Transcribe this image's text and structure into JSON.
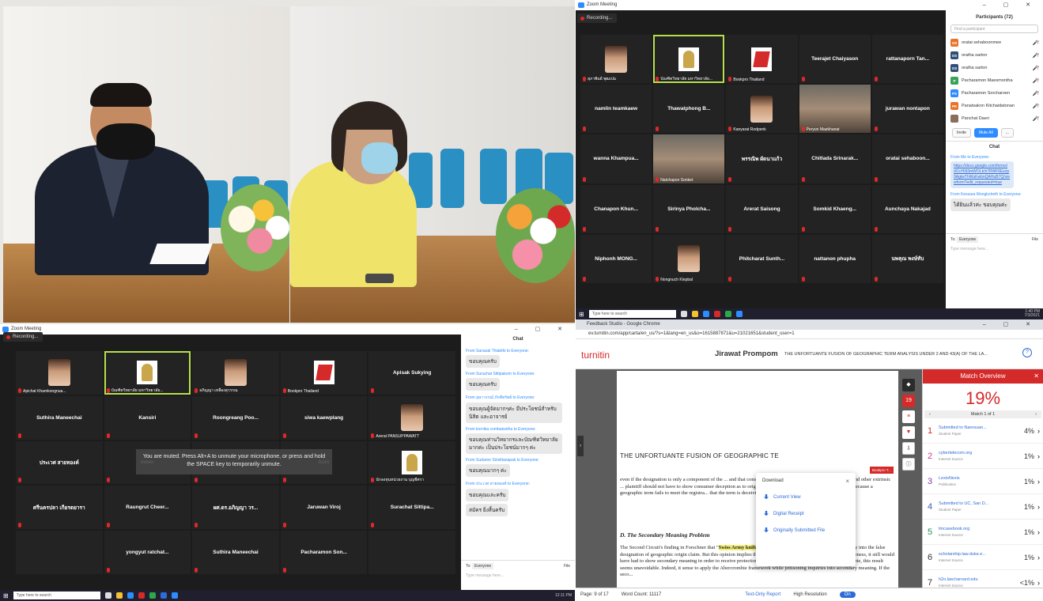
{
  "zoom_top": {
    "title": "Zoom Meeting",
    "recording": "Recording...",
    "tiles": [
      {
        "label": "",
        "name": "สุภาพิมย์ พุฒเปม",
        "kind": "face"
      },
      {
        "label": "",
        "name": "บัณฑิตวิทยาลัย มหาวิทยาลัย...",
        "kind": "emblem",
        "active": true
      },
      {
        "label": "",
        "name": "Bookpro Thailand",
        "kind": "redlogo"
      },
      {
        "label": "Teerajet Chaiyason",
        "name": "",
        "kind": "text"
      },
      {
        "label": "rattanaporn Tan...",
        "name": "",
        "kind": "text"
      },
      {
        "label": "namlin teamkaew",
        "name": "",
        "kind": "text"
      },
      {
        "label": "Thawatphong B...",
        "name": "",
        "kind": "text"
      },
      {
        "label": "",
        "name": "Kanyarat Rodpenk",
        "kind": "face"
      },
      {
        "label": "",
        "name": "Peryun Maekhanat",
        "kind": "video"
      },
      {
        "label": "jurawan nontapon",
        "name": "",
        "kind": "text"
      },
      {
        "label": "wanna Khampua...",
        "name": "",
        "kind": "text"
      },
      {
        "label": "",
        "name": "Natchapon Sonket",
        "kind": "video"
      },
      {
        "label": "พรรณิพ ผัดนาแก้ว",
        "name": "",
        "kind": "text"
      },
      {
        "label": "Chitlada Srinarak...",
        "name": "",
        "kind": "text"
      },
      {
        "label": "oratai sehaboon...",
        "name": "",
        "kind": "text"
      },
      {
        "label": "Chanapon Khun...",
        "name": "",
        "kind": "text"
      },
      {
        "label": "Sirinya Pholcha...",
        "name": "",
        "kind": "text"
      },
      {
        "label": "Arerat Saisong",
        "name": "",
        "kind": "text"
      },
      {
        "label": "Somkid Khaeng...",
        "name": "",
        "kind": "text"
      },
      {
        "label": "Aunchaya Nakajad",
        "name": "",
        "kind": "text"
      },
      {
        "label": "Niphonh MONG...",
        "name": "",
        "kind": "text"
      },
      {
        "label": "",
        "name": "Nongnuch Klepbal",
        "kind": "face"
      },
      {
        "label": "Phitcharat Sunth...",
        "name": "",
        "kind": "text"
      },
      {
        "label": "nattanon phupha",
        "name": "",
        "kind": "text"
      },
      {
        "label": "นพคุณ พงษ์ทับ",
        "name": "",
        "kind": "text"
      }
    ],
    "participants_title": "Participants (72)",
    "search_placeholder": "Find a participant",
    "participants": [
      {
        "initials": "OS",
        "name": "oratai sehaboonmee",
        "color": "#e8742a"
      },
      {
        "initials": "OS",
        "name": "oratha sarton",
        "color": "#2f4f7a"
      },
      {
        "initials": "OS",
        "name": "oratha sarton",
        "color": "#2f4f7a"
      },
      {
        "initials": "P",
        "name": "Pacharamon Maesmontha",
        "color": "#3aa35a"
      },
      {
        "initials": "PS",
        "name": "Pacharamon Sorcharoen",
        "color": "#2d8cff"
      },
      {
        "initials": "PK",
        "name": "Panatsaknn Kitchaidatonan",
        "color": "#e8742a"
      },
      {
        "initials": "",
        "name": "Panchat Daeri",
        "color": "#8a6d5a"
      }
    ],
    "invite": "Invite",
    "mute_all": "Mute All",
    "more": "...",
    "chat_title": "Chat",
    "chat": [
      {
        "meta": "From Me to Everyone:",
        "link": "https://docs.google.com/forms/d/1cH3t3mWOLtch7RWF6Ezzp9AgtwThWuKwbnQAHuB7Q/viewform?edit_requested=true"
      },
      {
        "meta": "From Kessara Mongkolreth to Everyone:",
        "text": "ได้ยินแล้วค่ะ ขอบคุณค่ะ"
      }
    ],
    "to_label": "To:",
    "to_value": "Everyone",
    "file": "File",
    "type_placeholder": "Type message here...",
    "taskbar_search": "Type here to search",
    "clock_time": "1:40 PM",
    "clock_date": "7/3/2021"
  },
  "zoom_bottom": {
    "title": "Zoom Meeting",
    "recording": "Recording...",
    "tiles": [
      {
        "label": "",
        "name": "Apichat Khamkongnua...",
        "kind": "face"
      },
      {
        "label": "",
        "name": "บัณฑิตวิทยาลัย มหาวิทยาลัย...",
        "kind": "emblem",
        "active": true
      },
      {
        "label": "",
        "name": "อภิญญา เหลืองสุวรรณ",
        "kind": "face"
      },
      {
        "label": "",
        "name": "Bookpro Thailand",
        "kind": "redlogo"
      },
      {
        "label": "Apisak Sukying",
        "name": "",
        "kind": "text"
      },
      {
        "label": "Suthira Maneechai",
        "name": "",
        "kind": "text"
      },
      {
        "label": "Kansiri",
        "name": "",
        "kind": "text"
      },
      {
        "label": "Roongreang Poo...",
        "name": "",
        "kind": "text"
      },
      {
        "label": "siwa kaewplang",
        "name": "",
        "kind": "text"
      },
      {
        "label": "",
        "name": "Arerat PANSUPPAWATT",
        "kind": "face"
      },
      {
        "label": "ประเวศ สายทองค์",
        "name": "",
        "kind": "text"
      },
      {
        "label": "kwan",
        "name": "",
        "kind": "text"
      },
      {
        "label": "",
        "name": "",
        "kind": "text"
      },
      {
        "label": "kum",
        "name": "",
        "kind": "text"
      },
      {
        "label": "",
        "name": "นักลงทุนหน่วยงาน บุญชีศรา",
        "kind": "emblem"
      },
      {
        "label": "ศรีนครปลา เกียรตยารา",
        "name": "",
        "kind": "text"
      },
      {
        "label": "Raungrut Cheer...",
        "name": "",
        "kind": "text"
      },
      {
        "label": "ผศ.ดร.อภิญญา วร...",
        "name": "",
        "kind": "text"
      },
      {
        "label": "Jaruwan Viroj",
        "name": "",
        "kind": "text"
      },
      {
        "label": "Surachat Sittipa...",
        "name": "",
        "kind": "text"
      },
      {
        "label": "",
        "name": "",
        "kind": "empty"
      },
      {
        "label": "yongyut ratchat...",
        "name": "",
        "kind": "text"
      },
      {
        "label": "Suthira Maneechai",
        "name": "",
        "kind": "text"
      },
      {
        "label": "Pacharamon Son...",
        "name": "",
        "kind": "text"
      },
      {
        "label": "",
        "name": "",
        "kind": "empty"
      }
    ],
    "muted_banner": "You are muted. Press Alt+A to unmute your microphone, or press and hold the SPACE key to temporarily unmute.",
    "chat_title": "Chat",
    "chat": [
      {
        "meta": "From Sarasak Thiabthi to Everyone:",
        "text": "ขอบคุณครับ"
      },
      {
        "meta": "From Surachat Sittipakorn to Everyone:",
        "text": "ขอบคุณครับ"
      },
      {
        "meta": "From อุษาวรรณ์ ภักดีทรัพย์ to Everyone:",
        "text": "ขอบคุณผู้จัดมากๆค่ะ มีประโยชน์สำหรับ นิสิต และอาจารย์"
      },
      {
        "meta": "From kornika combatsotha to Everyone:",
        "text": "ขอบคุณท่านวิทยากรและบัณฑิตวิทยาลัยมากค่ะ เป็นประโยชน์มากๆ ค่ะ"
      },
      {
        "meta": "From Sudaree Sirisittanapak to Everyone:",
        "text": "ขอบคุณมากๆ ค่ะ"
      },
      {
        "meta": "From ประเวศ สายทองค์ to Everyone:",
        "text": "ขอบคุณและครับ"
      },
      {
        "meta": "",
        "text": "สมัคร ยิ่งสิ้นครับ"
      }
    ],
    "to_label": "To:",
    "to_value": "Everyone",
    "file": "File",
    "type_placeholder": "Type message here...",
    "taskbar_search": "Type here to search",
    "clock_time": "12:11 PM",
    "clock_date": ""
  },
  "turnitin": {
    "window_title": "Feedback Studio - Google Chrome",
    "url": "ev.turnitin.com/app/carta/en_us/?s=1&lang=en_us&o=1615887871&u=21021651&student_user=1",
    "logo": "turnitin",
    "student": "Jirawat Prompom",
    "doc_title": "THE UNFORTUANTE FUSION OF GEOGRAPHIC TERM ANALYSIS UNDER 2 AND 43(A) OF THE LA...",
    "help": "?",
    "doc_heading": "THE UNFORTUANTE FUSION OF GEOGRAPHIC TE",
    "doc_para1": "even if the designation is only a component of the ... and that consumers were deceived (presumably via surveys and other extrinsic ... plaintiff should not have to show consumer deception as to origin simply becau... component of a larger mark, because a geographic term fails to meet the registra... that the term is deceiving consumers.",
    "doc_subhead": "D. The Secondary Meaning Problem",
    "doc_para2a": "The Second Circuit's finding in Forschner that \"",
    "doc_hl1": "Swiss Army knife",
    "doc_para2b": "\" was not geographically descriptive ev... inquiry into the false designation of geographic origin claim. But this opinion implies that if Forschner had n... of geographic descriptiveness, it still would have had to show secondary meaning in order to receive protection. If the court wanted to be faithful to Abercrombie, this result seems unavoidable. Indeed, it sense to apply the Abercrombie framework while jettisoning inquiries into secondary meaning. If the seco...",
    "bookpro_tag": "Bookpro T...",
    "tool_count": "19",
    "download_title": "Download",
    "download_items": [
      "Current View",
      "Digital Receipt",
      "Originally Submitted File"
    ],
    "match_title": "Match Overview",
    "match_percent": "19%",
    "match_nav": "Match 1 of 1",
    "matches": [
      {
        "n": "1",
        "src": "Submitted to Naresuan...",
        "type": "Student Paper",
        "pct": "4%",
        "color": "#d52a2a"
      },
      {
        "n": "2",
        "src": "cybertelecom.org",
        "type": "Internet Source",
        "pct": "1%",
        "color": "#c63c8c"
      },
      {
        "n": "3",
        "src": "LexisNexis",
        "type": "Publication",
        "pct": "1%",
        "color": "#8a3aa8"
      },
      {
        "n": "4",
        "src": "Submitted to UC, San D...",
        "type": "Student Paper",
        "pct": "1%",
        "color": "#3a5ab8"
      },
      {
        "n": "5",
        "src": "tmcasebook.org",
        "type": "Internet Source",
        "pct": "1%",
        "color": "#2a8c5a"
      },
      {
        "n": "6",
        "src": "scholarship.law.duke.e...",
        "type": "Internet Source",
        "pct": "1%",
        "color": "#333333"
      },
      {
        "n": "7",
        "src": "h2o.law.harvard.edu",
        "type": "Internet Source",
        "pct": "<1%",
        "color": "#333333"
      }
    ],
    "page": "Page: 9 of 17",
    "word_count": "Word Count: 11117",
    "text_only": "Text-Only Report",
    "high_res": "High Resolution",
    "on": "On"
  }
}
